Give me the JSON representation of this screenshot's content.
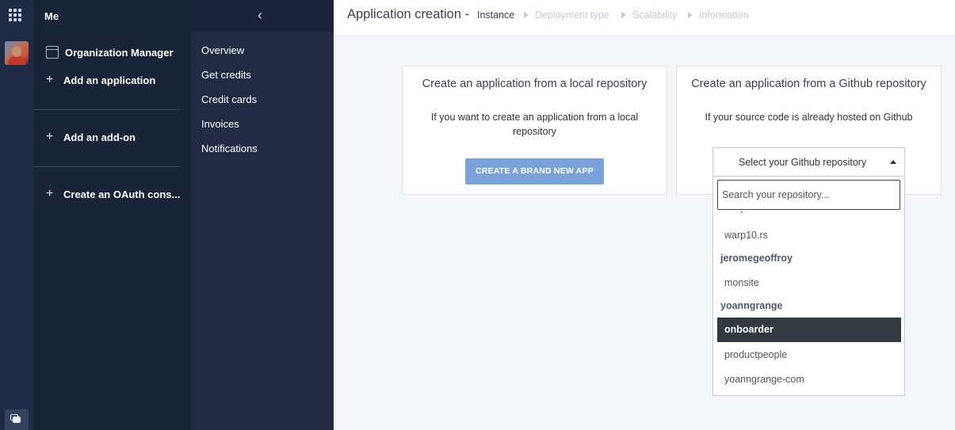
{
  "org": {
    "me_label": "Me",
    "organization_manager": "Organization Manager",
    "add_application": "Add an application",
    "add_addon": "Add an add-on",
    "create_oauth": "Create an OAuth cons..."
  },
  "nav": {
    "items": [
      {
        "label": "Overview"
      },
      {
        "label": "Get credits"
      },
      {
        "label": "Credit cards"
      },
      {
        "label": "Invoices"
      },
      {
        "label": "Notifications"
      }
    ]
  },
  "header": {
    "title": "Application creation -",
    "steps": [
      {
        "label": "Instance",
        "state": "active"
      },
      {
        "label": "Deployment type",
        "state": "inactive"
      },
      {
        "label": "Scalability",
        "state": "inactive"
      },
      {
        "label": "Information",
        "state": "inactive"
      }
    ]
  },
  "local_card": {
    "title": "Create an application from a local repository",
    "description": "If you want to create an application from a local repository",
    "button": "CREATE A BRAND NEW APP"
  },
  "github_card": {
    "title": "Create an application from a Github repository",
    "description": "If your source code is already hosted on Github",
    "select_value": "Select your Github repository",
    "search_placeholder": "Search your repository...",
    "options": [
      {
        "label": "warp10.rs",
        "type": "option"
      },
      {
        "label": "jeromegeoffroy",
        "type": "group"
      },
      {
        "label": "monsite",
        "type": "option"
      },
      {
        "label": "yoanngrange",
        "type": "group"
      },
      {
        "label": "onboarder",
        "type": "option",
        "selected": true
      },
      {
        "label": "productpeople",
        "type": "option"
      },
      {
        "label": "yoanngrange-com",
        "type": "option"
      }
    ]
  },
  "colors": {
    "rail": "#1f2b45",
    "sidebar": "#1a2438",
    "nav": "#222a44",
    "button": "#79a3d9",
    "selected_option": "#343a42"
  }
}
